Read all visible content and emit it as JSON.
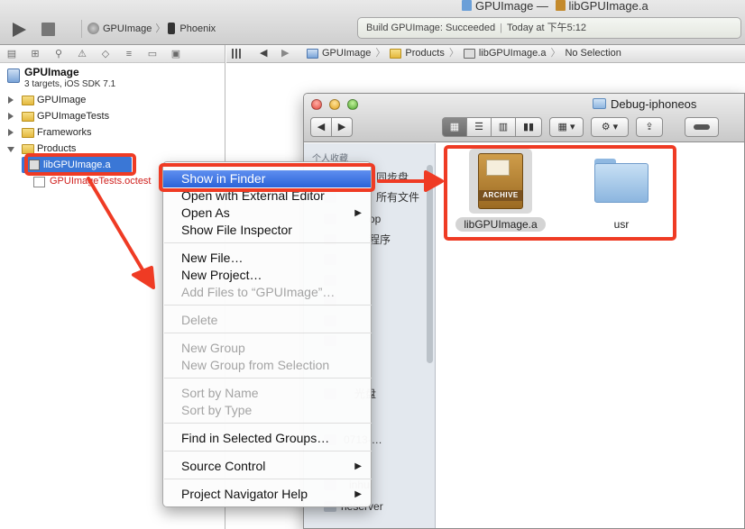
{
  "xcode": {
    "window_title": "GPUImage — ",
    "window_file": "libGPUImage.a",
    "scheme": "GPUImage",
    "destination": "Phoenix",
    "activity_status": "Build GPUImage: Succeeded",
    "activity_time": "Today at 下午5:12"
  },
  "navigator": {
    "project_name": "GPUImage",
    "project_subtitle": "3 targets, iOS SDK 7.1",
    "tree": {
      "gpuimage": "GPUImage",
      "tests": "GPUImageTests",
      "frameworks": "Frameworks",
      "products": "Products",
      "lib": "libGPUImage.a",
      "octest": "GPUImageTests.octest"
    }
  },
  "jumpbar": {
    "crumbs": [
      "GPUImage",
      "Products",
      "libGPUImage.a",
      "No Selection"
    ]
  },
  "finder": {
    "title": "Debug-iphoneos",
    "sidebar_heading": "个人收藏",
    "sidebar_items": [
      "同步盘",
      "所有文件",
      "op",
      "程序",
      "光盘",
      "0713-…",
      "inhui",
      "neserver"
    ],
    "items": [
      {
        "name": "libGPUImage.a",
        "icon_label": "ARCHIVE"
      },
      {
        "name": "usr"
      }
    ],
    "buttons": {
      "back": "◀",
      "forward": "▶",
      "action": "⚙ ▾",
      "arrange": "▦ ▾",
      "share": "⇪"
    }
  },
  "context_menu": {
    "items": {
      "show_in_finder": "Show in Finder",
      "open_external": "Open with External Editor",
      "open_as": "Open As",
      "show_inspector": "Show File Inspector",
      "new_file": "New File…",
      "new_project": "New Project…",
      "add_files": "Add Files to “GPUImage”…",
      "delete": "Delete",
      "new_group": "New Group",
      "new_group_sel": "New Group from Selection",
      "sort_name": "Sort by Name",
      "sort_type": "Sort by Type",
      "find_groups": "Find in Selected Groups…",
      "source_control": "Source Control",
      "nav_help": "Project Navigator Help"
    },
    "submenu_arrow": "▶"
  },
  "colors": {
    "highlight": "#ef3b24",
    "selection": "#3a77d6"
  }
}
